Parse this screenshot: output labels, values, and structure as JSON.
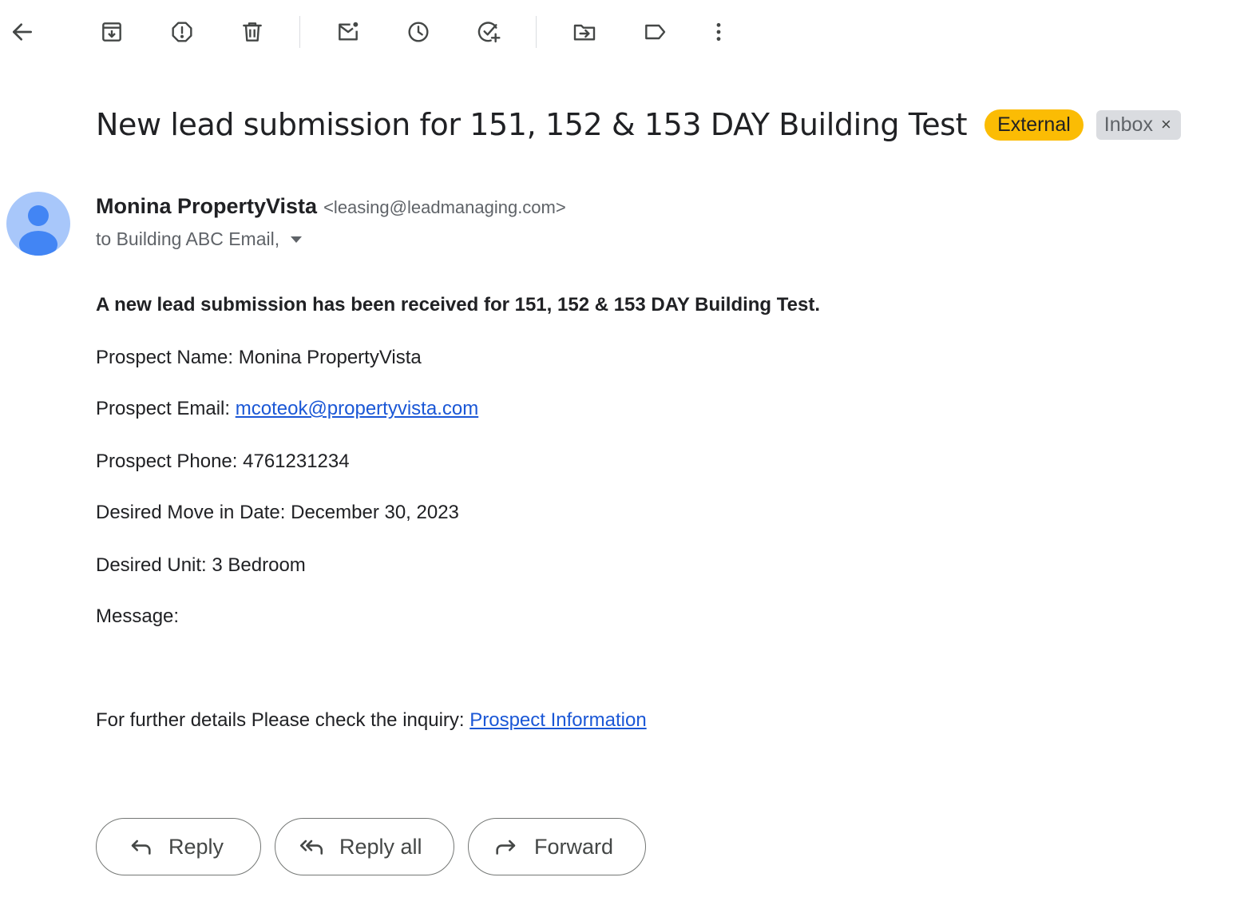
{
  "toolbar": {
    "icons": [
      "back-arrow-icon",
      "archive-icon",
      "report-spam-icon",
      "delete-icon",
      "mark-unread-icon",
      "snooze-icon",
      "add-to-tasks-icon",
      "move-to-icon",
      "label-icon",
      "more-options-icon"
    ]
  },
  "email": {
    "subject": "New lead submission for 151, 152 & 153 DAY Building Test",
    "labels": {
      "external": "External",
      "inbox": "Inbox",
      "remove_symbol": "×"
    },
    "sender": {
      "name": "Monina PropertyVista",
      "email": "<leasing@leadmanaging.com>"
    },
    "recipients": "to Building ABC Email,",
    "body": {
      "intro": "A new lead submission has been received for 151, 152 & 153 DAY Building Test.",
      "name_label": "Prospect Name:",
      "name_value": "Monina PropertyVista",
      "email_label": "Prospect Email:",
      "email_value": "mcoteok@propertyvista.com",
      "phone_label": "Prospect Phone:",
      "phone_value": "4761231234",
      "move_in_label": "Desired Move in Date:",
      "move_in_value": "December 30, 2023",
      "unit_label": "Desired Unit:",
      "unit_value": "3 Bedroom",
      "message_label": "Message:",
      "details_text": "For further details Please check the inquiry:",
      "details_link": "Prospect Information"
    }
  },
  "actions": {
    "reply": "Reply",
    "reply_all": "Reply all",
    "forward": "Forward"
  },
  "colors": {
    "external_badge": "#fbbc04",
    "inbox_badge": "#dadce0",
    "link": "#1a57d6",
    "avatar_bg": "#a8c7fa",
    "avatar_fg": "#4285f4"
  }
}
